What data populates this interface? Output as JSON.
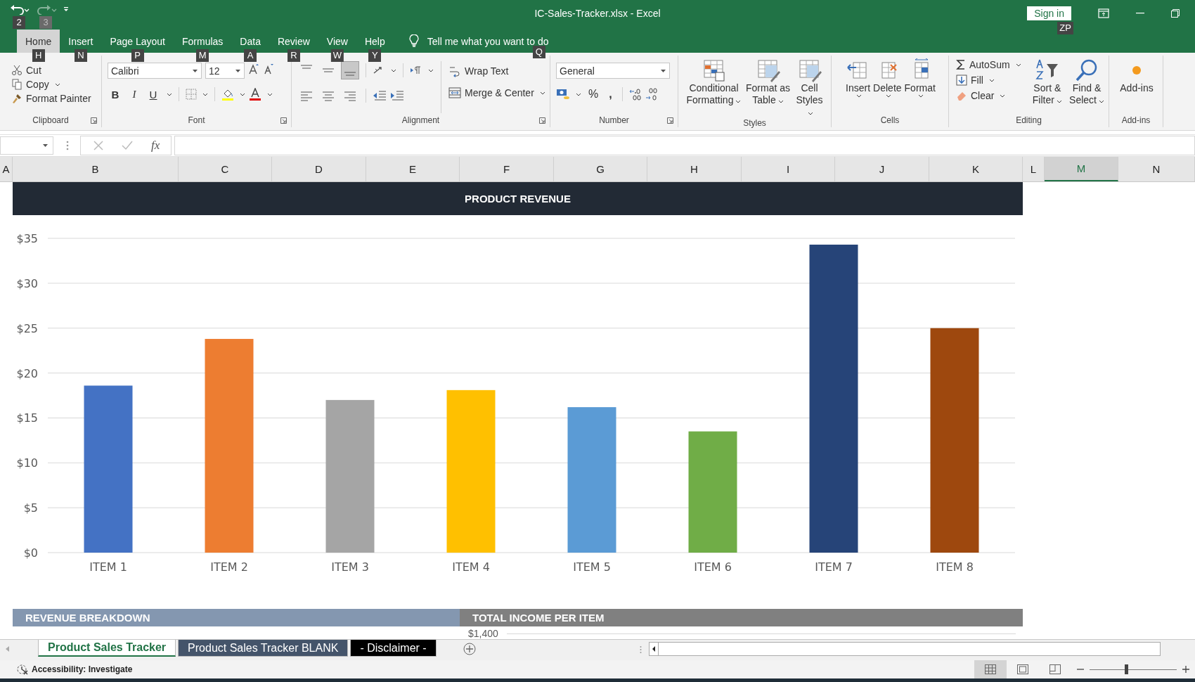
{
  "quick_access": [
    {
      "kind": "undo",
      "keytip": "2",
      "disabled": false
    },
    {
      "kind": "redo",
      "keytip": "3",
      "disabled": true
    }
  ],
  "window": {
    "title": "IC-Sales-Tracker.xlsx  -  Excel",
    "sign_in": "Sign in",
    "sign_in_keytip": "ZP"
  },
  "ribbon_tabs": [
    {
      "label": "Home",
      "keytip": "H",
      "selected": true
    },
    {
      "label": "Insert",
      "keytip": "N",
      "selected": false
    },
    {
      "label": "Page Layout",
      "keytip": "P",
      "selected": false
    },
    {
      "label": "Formulas",
      "keytip": "M",
      "selected": false
    },
    {
      "label": "Data",
      "keytip": "A",
      "selected": false
    },
    {
      "label": "Review",
      "keytip": "R",
      "selected": false
    },
    {
      "label": "View",
      "keytip": "W",
      "selected": false
    },
    {
      "label": "Help",
      "keytip": "Y",
      "selected": false
    }
  ],
  "tell_me": {
    "placeholder": "Tell me what you want to do",
    "keytip": "Q"
  },
  "ribbon": {
    "clipboard": {
      "label": "Clipboard",
      "cut": "Cut",
      "copy": "Copy",
      "format_painter": "Format Painter"
    },
    "font": {
      "label": "Font",
      "font_name": "Calibri",
      "font_size": "12",
      "bold": "B",
      "italic": "I",
      "underline": "U"
    },
    "alignment": {
      "label": "Alignment",
      "wrap_text": "Wrap Text",
      "merge_center": "Merge & Center"
    },
    "number": {
      "label": "Number",
      "format": "General",
      "percent": "%",
      "comma": ","
    },
    "styles": {
      "label": "Styles",
      "buttons": [
        "Conditional Formatting",
        "Format as Table",
        "Cell Styles"
      ]
    },
    "cells": {
      "label": "Cells",
      "buttons": [
        "Insert",
        "Delete",
        "Format"
      ]
    },
    "editing": {
      "label": "Editing",
      "autosum": "AutoSum",
      "fill": "Fill",
      "clear": "Clear",
      "sort_filter": "Sort & Filter",
      "find_select": "Find & Select"
    },
    "addins": {
      "label": "Add-ins",
      "button": "Add-ins"
    }
  },
  "formula_bar": {
    "function_label": "fx"
  },
  "columns": [
    {
      "label": "A",
      "selected": false
    },
    {
      "label": "B",
      "selected": false
    },
    {
      "label": "C",
      "selected": false
    },
    {
      "label": "D",
      "selected": false
    },
    {
      "label": "E",
      "selected": false
    },
    {
      "label": "F",
      "selected": false
    },
    {
      "label": "G",
      "selected": false
    },
    {
      "label": "H",
      "selected": false
    },
    {
      "label": "I",
      "selected": false
    },
    {
      "label": "J",
      "selected": false
    },
    {
      "label": "K",
      "selected": false
    },
    {
      "label": "L",
      "selected": false
    },
    {
      "label": "M",
      "selected": true
    },
    {
      "label": "N",
      "selected": false
    }
  ],
  "sheet": {
    "header": "PRODUCT REVENUE",
    "chart": {
      "chart_data": {
        "type": "bar",
        "categories": [
          "ITEM 1",
          "ITEM 2",
          "ITEM 3",
          "ITEM 4",
          "ITEM 5",
          "ITEM 6",
          "ITEM 7",
          "ITEM 8"
        ],
        "series": [
          {
            "values": [
              18.6,
              23.8,
              17.0,
              18.1,
              16.2,
              13.5,
              34.3,
              25.0
            ],
            "colors": [
              "#4472c4",
              "#ed7d31",
              "#a5a5a5",
              "#ffc000",
              "#5b9bd5",
              "#70ad47",
              "#264478",
              "#9e480e"
            ]
          }
        ],
        "ylim": [
          0,
          35
        ],
        "grid": true,
        "yticks": [
          {
            "value": 0,
            "label": "$0"
          },
          {
            "value": 5,
            "label": "$5"
          },
          {
            "value": 10,
            "label": "$10"
          },
          {
            "value": 15,
            "label": "$15"
          },
          {
            "value": 20,
            "label": "$20"
          },
          {
            "value": 25,
            "label": "$25"
          },
          {
            "value": 30,
            "label": "$30"
          },
          {
            "value": 35,
            "label": "$35"
          }
        ]
      }
    },
    "sections": [
      {
        "title": "REVENUE BREAKDOWN",
        "color": "#8497b0"
      },
      {
        "title": "TOTAL INCOME PER ITEM",
        "color": "#808080"
      }
    ],
    "income_axis_label": "$1,400"
  },
  "sheet_tabs": [
    {
      "label": "Product Sales Tracker",
      "selected": true
    },
    {
      "label": "Product Sales Tracker BLANK",
      "selected": false,
      "color": "#44546a"
    },
    {
      "label": "- Disclaimer -",
      "selected": false,
      "color": "#000000"
    }
  ],
  "status_bar": {
    "accessibility": "Accessibility: Investigate",
    "views": [
      {
        "kind": "normal",
        "selected": true
      },
      {
        "kind": "page_layout",
        "selected": false
      },
      {
        "kind": "page_break",
        "selected": false
      }
    ],
    "zoom_slider": {
      "level": 0.42
    }
  }
}
